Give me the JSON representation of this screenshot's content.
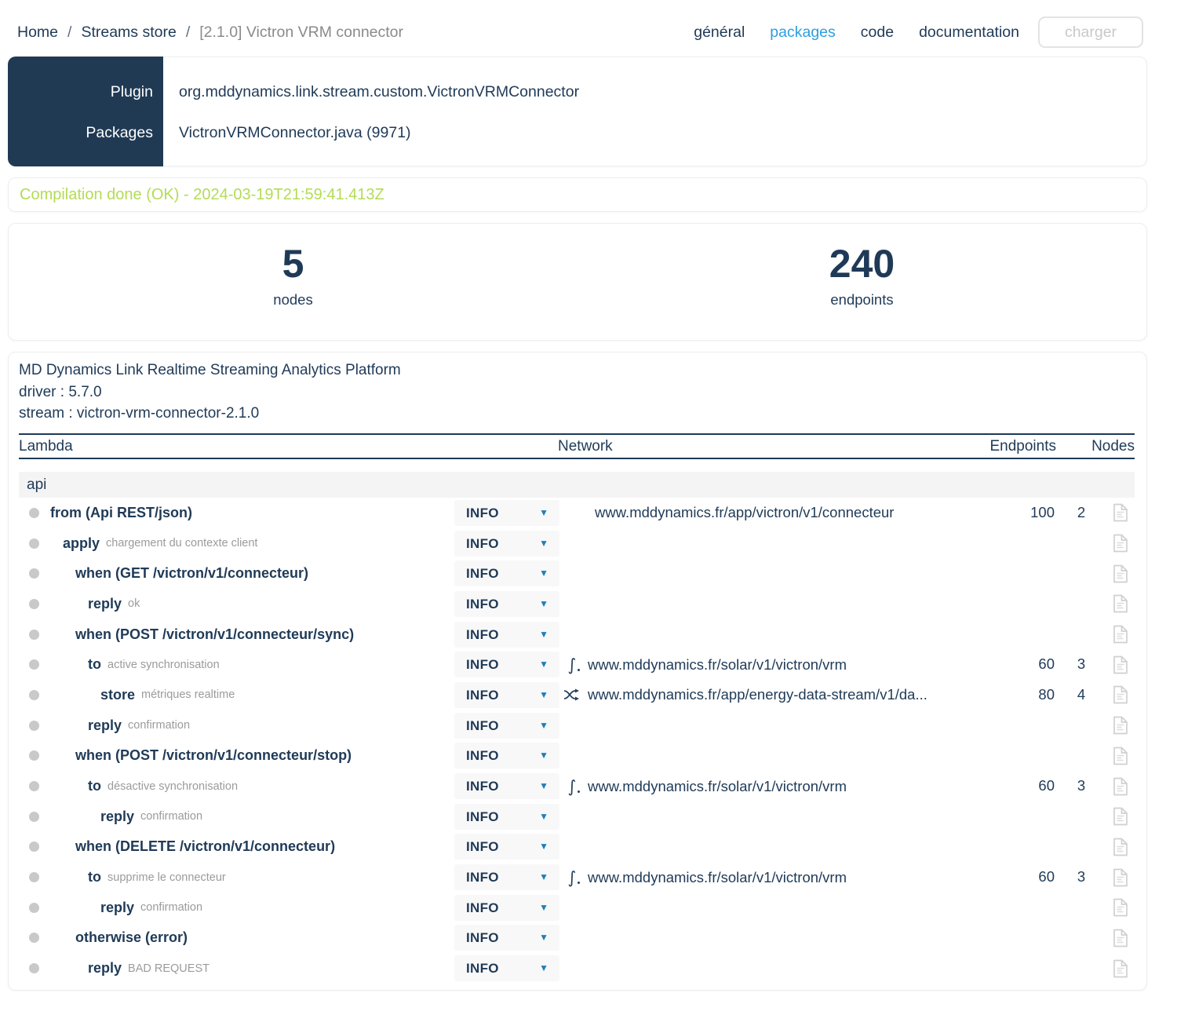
{
  "breadcrumb": {
    "separator": "/",
    "items": [
      "Home",
      "Streams store",
      "[2.1.0] Victron VRM connector"
    ]
  },
  "nav": {
    "tabs": [
      {
        "label": "général",
        "active": false
      },
      {
        "label": "packages",
        "active": true
      },
      {
        "label": "code",
        "active": false
      },
      {
        "label": "documentation",
        "active": false
      }
    ],
    "charger_label": "charger"
  },
  "plugin_panel": {
    "rows": [
      {
        "label": "Plugin",
        "value": "org.mddynamics.link.stream.custom.VictronVRMConnector"
      },
      {
        "label": "Packages",
        "value": "VictronVRMConnector.java (9971)"
      }
    ]
  },
  "compilation": {
    "message": "Compilation done (OK) - 2024-03-19T21:59:41.413Z",
    "status_color": "#b3dc55"
  },
  "stats": [
    {
      "value": "5",
      "label": "nodes"
    },
    {
      "value": "240",
      "label": "endpoints"
    }
  ],
  "platform": {
    "title": "MD Dynamics Link Realtime Streaming Analytics Platform",
    "driver": "driver : 5.7.0",
    "stream": "stream : victron-vrm-connector-2.1.0"
  },
  "table": {
    "headers": {
      "lambda": "Lambda",
      "network": "Network",
      "endpoints": "Endpoints",
      "nodes": "Nodes"
    },
    "group": "api",
    "rows": [
      {
        "keyword": "from (Api REST/json)",
        "annotation": "",
        "indent": 0,
        "level": "INFO",
        "network": {
          "icon": null,
          "url": "www.mddynamics.fr/app/victron/v1/connecteur"
        },
        "endpoints": "100",
        "nodes": "2"
      },
      {
        "keyword": "apply",
        "annotation": "chargement du contexte client",
        "indent": 1,
        "level": "INFO"
      },
      {
        "keyword": "when (GET /victron/v1/connecteur)",
        "annotation": "",
        "indent": 2,
        "level": "INFO"
      },
      {
        "keyword": "reply",
        "annotation": "ok",
        "indent": 3,
        "level": "INFO"
      },
      {
        "keyword": "when (POST /victron/v1/connecteur/sync)",
        "annotation": "",
        "indent": 2,
        "level": "INFO"
      },
      {
        "keyword": "to",
        "annotation": "active synchronisation",
        "indent": 3,
        "level": "INFO",
        "network": {
          "icon": "function",
          "url": "www.mddynamics.fr/solar/v1/victron/vrm"
        },
        "endpoints": "60",
        "nodes": "3"
      },
      {
        "keyword": "store",
        "annotation": "métriques realtime",
        "indent": 4,
        "level": "INFO",
        "network": {
          "icon": "shuffle",
          "url": "www.mddynamics.fr/app/energy-data-stream/v1/da..."
        },
        "endpoints": "80",
        "nodes": "4"
      },
      {
        "keyword": "reply",
        "annotation": "confirmation",
        "indent": 3,
        "level": "INFO"
      },
      {
        "keyword": "when (POST /victron/v1/connecteur/stop)",
        "annotation": "",
        "indent": 2,
        "level": "INFO"
      },
      {
        "keyword": "to",
        "annotation": "désactive synchronisation",
        "indent": 3,
        "level": "INFO",
        "network": {
          "icon": "function",
          "url": "www.mddynamics.fr/solar/v1/victron/vrm"
        },
        "endpoints": "60",
        "nodes": "3"
      },
      {
        "keyword": "reply",
        "annotation": "confirmation",
        "indent": 4,
        "level": "INFO"
      },
      {
        "keyword": "when (DELETE /victron/v1/connecteur)",
        "annotation": "",
        "indent": 2,
        "level": "INFO"
      },
      {
        "keyword": "to",
        "annotation": "supprime le connecteur",
        "indent": 3,
        "level": "INFO",
        "network": {
          "icon": "function",
          "url": "www.mddynamics.fr/solar/v1/victron/vrm"
        },
        "endpoints": "60",
        "nodes": "3"
      },
      {
        "keyword": "reply",
        "annotation": "confirmation",
        "indent": 4,
        "level": "INFO"
      },
      {
        "keyword": "otherwise (error)",
        "annotation": "",
        "indent": 2,
        "level": "INFO"
      },
      {
        "keyword": "reply",
        "annotation": "BAD REQUEST",
        "indent": 3,
        "level": "INFO"
      }
    ]
  },
  "colors": {
    "navy": "#1f3a57",
    "accent_blue": "#2d9fe0",
    "caret_blue": "#1d7fba",
    "success_green": "#b3dc55",
    "annotation_gray": "#9b9b9b"
  }
}
